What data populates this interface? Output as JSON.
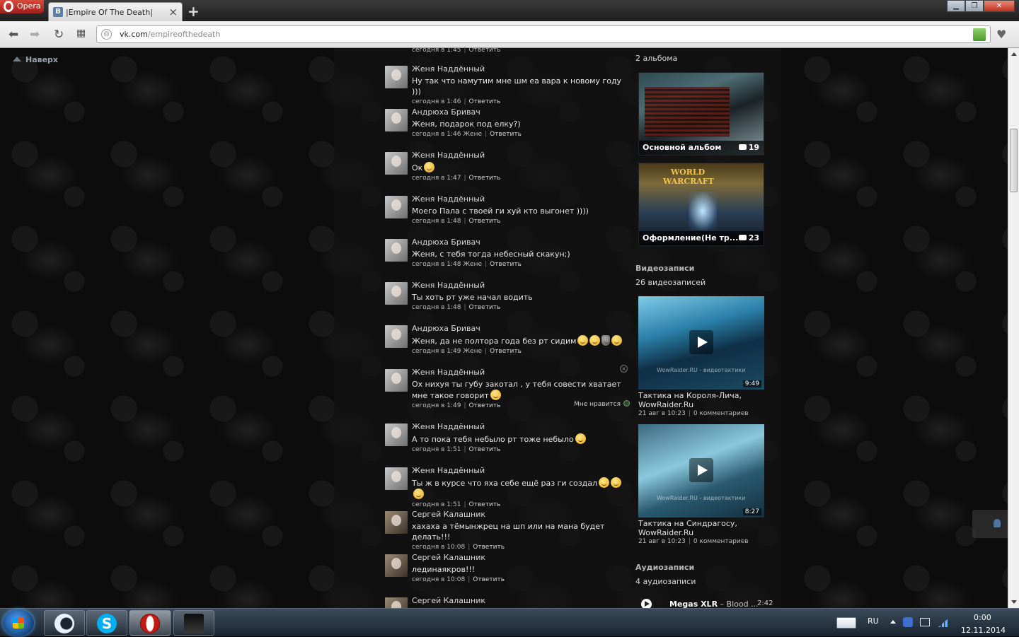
{
  "browser": {
    "menu_label": "Opera",
    "tab_favicon": "B",
    "tab_title": "|Empire Of The Death|",
    "tab_close": "×",
    "new_tab": "+",
    "address_host": "vk.com",
    "address_path": "/empireofthedeath",
    "window_buttons": [
      "▁",
      "❐",
      "✕"
    ]
  },
  "page": {
    "back_to_top": "Наверх",
    "top_meta_time": "сегодня в 1:45",
    "reply_label": "Ответить",
    "like_label": "Мне нравится"
  },
  "comments": [
    {
      "author": "Женя Наддённый",
      "text": "Ну так что намутим мне шм еа вара к новому году )))",
      "emoji": 0,
      "time": "сегодня в 1:46",
      "to": "",
      "avatar": "girl"
    },
    {
      "author": "Андрюха Бривач",
      "text": "Женя, подарок под елку?)",
      "emoji": 0,
      "time": "сегодня в 1:46",
      "to": "Жене",
      "avatar": "girl"
    },
    {
      "author": "Женя Наддённый",
      "text": "Ок",
      "emoji": 1,
      "time": "сегодня в 1:47",
      "to": "",
      "avatar": "girl"
    },
    {
      "author": "Женя Наддённый",
      "text": "Моего Пала с твоей ги хуй кто выгонет ))))",
      "emoji": 0,
      "time": "сегодня в 1:48",
      "to": "",
      "avatar": "girl"
    },
    {
      "author": "Андрюха Бривач",
      "text": "Женя, с тебя тогда небесный скакун;)",
      "emoji": 0,
      "time": "сегодня в 1:48",
      "to": "Жене",
      "avatar": "girl"
    },
    {
      "author": "Женя Наддённый",
      "text": "Ты хоть рт уже начал водить",
      "emoji": 0,
      "time": "сегодня в 1:48",
      "to": "",
      "avatar": "girl"
    },
    {
      "author": "Андрюха Бривач",
      "text": "Женя, да не полтора года без рт сидим",
      "emoji": 4,
      "time": "сегодня в 1:49",
      "to": "Жене",
      "avatar": "girl"
    },
    {
      "author": "Женя Наддённый",
      "text": "Ох нихуя ты губу закотал , у тебя совести хватает мне такое говорит",
      "emoji": 1,
      "time": "сегодня в 1:49",
      "to": "",
      "avatar": "girl",
      "liked": true
    },
    {
      "author": "Женя Наддённый",
      "text": "А то пока тебя небыло рт тоже небыло",
      "emoji": 1,
      "time": "сегодня в 1:51",
      "to": "",
      "avatar": "girl"
    },
    {
      "author": "Женя Наддённый",
      "text": "Ты ж в курсе что яха себе ещё раз ги создал",
      "emoji": 3,
      "time": "сегодня в 1:51",
      "to": "",
      "avatar": "girl"
    },
    {
      "author": "Сергей Калашник",
      "text": "хахаха а тёмынжрец на шп или на мана будет делать!!!",
      "emoji": 0,
      "time": "сегодня в 10:08",
      "to": "",
      "avatar": "sergey"
    },
    {
      "author": "Сергей Калашник",
      "text": "лединаякров!!!",
      "emoji": 0,
      "time": "сегодня в 10:08",
      "to": "",
      "avatar": "sergey"
    },
    {
      "author": "Сергей Калашник",
      "text": "",
      "emoji": 0,
      "time": "",
      "to": "",
      "avatar": "sergey"
    }
  ],
  "sidebar": {
    "albums_count": "2 альбома",
    "albums": [
      {
        "title": "Основной альбом",
        "count": "19"
      },
      {
        "title": "Оформление(Не тр...",
        "count": "23",
        "logo": "WORLD WARCRAFT"
      }
    ],
    "videos_heading": "Видеозаписи",
    "videos_count": "26 видеозаписей",
    "videos": [
      {
        "title": "Тактика на Короля-Лича, WowRaider.Ru",
        "duration": "9:49",
        "date": "21 авг в 10:23",
        "comments": "0 комментариев",
        "watermark": "WowRaider.RU - видеотактики"
      },
      {
        "title": "Тактика на Синдрагосу, WowRaider.Ru",
        "duration": "8:27",
        "date": "21 авг в 10:23",
        "comments": "0 комментариев",
        "watermark": "WowRaider.RU - видеотактики"
      }
    ],
    "audio_heading": "Аудиозаписи",
    "audio_count": "4 аудиозаписи",
    "audio_track": {
      "artist": "Megas XLR",
      "title": " – Blood ...",
      "duration": "2:42"
    }
  },
  "taskbar": {
    "language": "RU",
    "time": "0:00",
    "date": "12.11.2014",
    "skype_letter": "S"
  },
  "icons": [
    "opera-logo-icon",
    "vk-favicon-icon",
    "back-arrow-icon",
    "forward-arrow-icon",
    "reload-icon",
    "speed-dial-icon",
    "globe-icon",
    "extension-icon",
    "heart-icon",
    "up-arrow-icon",
    "camera-icon",
    "play-icon",
    "windows-flag-icon",
    "skype-icon",
    "opera-icon",
    "pen-icon"
  ]
}
